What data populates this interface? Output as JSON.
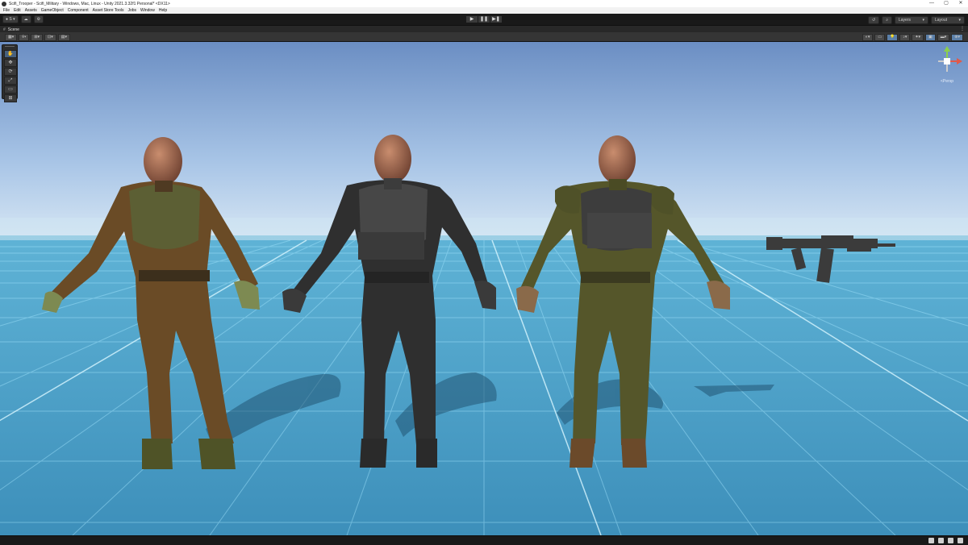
{
  "window": {
    "title": "Scifi_Trooper - Scifi_Military - Windows, Mac, Linux - Unity 2021.3.32f1 Personal* <DX11>",
    "controls": {
      "minimize": "—",
      "maximize": "▢",
      "close": "✕"
    }
  },
  "menu": [
    "File",
    "Edit",
    "Assets",
    "GameObject",
    "Component",
    "Asset Store Tools",
    "Jobs",
    "Window",
    "Help"
  ],
  "toolbar": {
    "account_label": "S",
    "account_icon": "account-icon",
    "cloud_icon": "cloud-icon",
    "settings_icon": "gear-icon",
    "play_icons": [
      "play-icon",
      "pause-icon",
      "step-icon"
    ],
    "play_glyphs": [
      "▶",
      "❚❚",
      "▶❚"
    ],
    "history_icon": "history-icon",
    "search_icon": "search-icon",
    "layers_label": "Layers",
    "layout_label": "Layout"
  },
  "scene_tab": {
    "hash": "#",
    "label": "Scene",
    "more": "⋮"
  },
  "scene_toolbar": {
    "left_buttons": [
      "▦▾",
      "⌾▾",
      "⊞▾",
      "⊡▾",
      "▤▾"
    ],
    "right_buttons": [
      "◐▾",
      "▭",
      "💡",
      "♪▾",
      "✦▾",
      "▣",
      "▬▾",
      "⊕▾"
    ]
  },
  "tools": [
    {
      "name": "hand-tool",
      "glyph": "✋"
    },
    {
      "name": "move-tool",
      "glyph": "✥"
    },
    {
      "name": "rotate-tool",
      "glyph": "⟳"
    },
    {
      "name": "scale-tool",
      "glyph": "⤢"
    },
    {
      "name": "rect-tool",
      "glyph": "▭"
    },
    {
      "name": "transform-tool",
      "glyph": "⊞"
    }
  ],
  "gizmo": {
    "label": "<Persp"
  },
  "colors": {
    "sky_top": "#6d8fc2",
    "sky_bottom": "#c6d8ee",
    "floor": "#4a9dc4",
    "grid": "#9fe4ff"
  },
  "scene_objects": [
    {
      "name": "trooper-brown",
      "suit": "#6a4b26",
      "vest": "#5c5f34",
      "glove": "#7d8a52",
      "boot": "#4f5327"
    },
    {
      "name": "trooper-black",
      "suit": "#2f2f2f",
      "vest": "#444",
      "glove": "#3a3a3a",
      "boot": "#2a2a2a"
    },
    {
      "name": "trooper-green",
      "suit": "#55562a",
      "vest": "#3d3d3d",
      "glove": "#8a6a4a",
      "boot": "#6b4a2a"
    },
    {
      "name": "assault-rifle",
      "color": "#3b3b3b"
    }
  ]
}
